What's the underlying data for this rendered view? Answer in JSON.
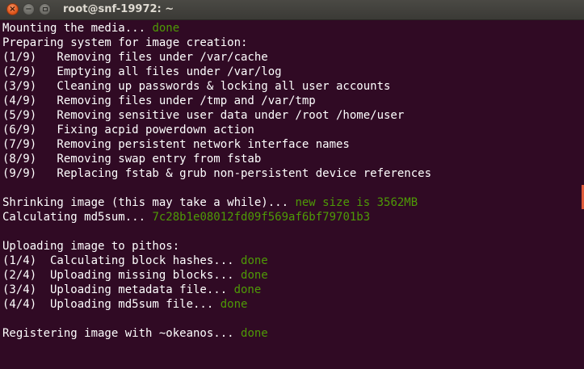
{
  "window": {
    "title": "root@snf-19972: ~",
    "close_glyph": "×",
    "minimize_glyph": "−"
  },
  "terminal": {
    "lines": [
      {
        "text": "Mounting the media... ",
        "status": "done"
      },
      {
        "text": "Preparing system for image creation:",
        "status": ""
      },
      {
        "text": "(1/9)   Removing files under /var/cache",
        "status": ""
      },
      {
        "text": "(2/9)   Emptying all files under /var/log",
        "status": ""
      },
      {
        "text": "(3/9)   Cleaning up passwords & locking all user accounts",
        "status": ""
      },
      {
        "text": "(4/9)   Removing files under /tmp and /var/tmp",
        "status": ""
      },
      {
        "text": "(5/9)   Removing sensitive user data under /root /home/user",
        "status": ""
      },
      {
        "text": "(6/9)   Fixing acpid powerdown action",
        "status": ""
      },
      {
        "text": "(7/9)   Removing persistent network interface names",
        "status": ""
      },
      {
        "text": "(8/9)   Removing swap entry from fstab",
        "status": ""
      },
      {
        "text": "(9/9)   Replacing fstab & grub non-persistent device references",
        "status": ""
      },
      {
        "text": "",
        "status": ""
      },
      {
        "text": "Shrinking image (this may take a while)... ",
        "status": "new size is 3562MB"
      },
      {
        "text": "Calculating md5sum... ",
        "status": "7c28b1e08012fd09f569af6bf79701b3"
      },
      {
        "text": "",
        "status": ""
      },
      {
        "text": "Uploading image to pithos:",
        "status": ""
      },
      {
        "text": "(1/4)  Calculating block hashes... ",
        "status": "done"
      },
      {
        "text": "(2/4)  Uploading missing blocks... ",
        "status": "done"
      },
      {
        "text": "(3/4)  Uploading metadata file... ",
        "status": "done"
      },
      {
        "text": "(4/4)  Uploading md5sum file... ",
        "status": "done"
      },
      {
        "text": "",
        "status": ""
      },
      {
        "text": "Registering image with ~okeanos... ",
        "status": "done"
      }
    ]
  },
  "colors": {
    "background": "#300a24",
    "text": "#ffffff",
    "status_green": "#4e9a06",
    "close_button": "#e2581e"
  },
  "icons": [
    "close-icon",
    "minimize-icon",
    "maximize-icon"
  ]
}
